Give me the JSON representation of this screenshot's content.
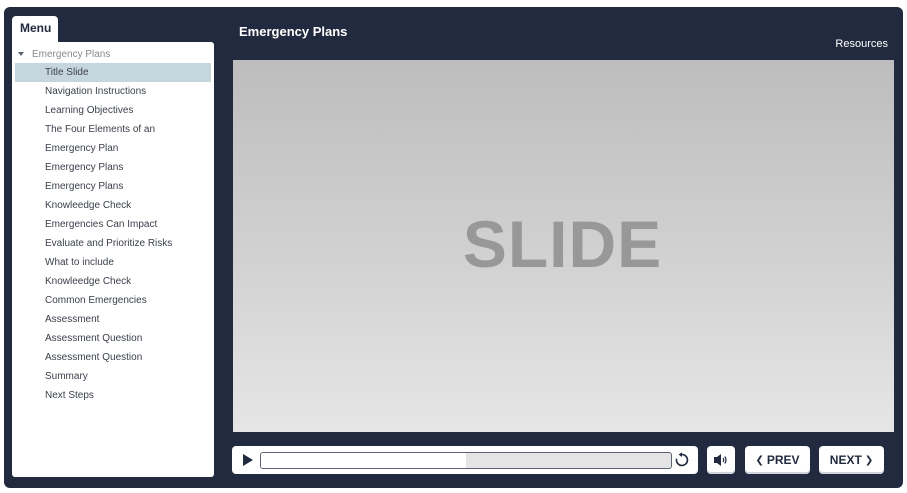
{
  "menu": {
    "tab_label": "Menu",
    "root_label": "Emergency Plans",
    "items": [
      {
        "label": "Title Slide",
        "active": true
      },
      {
        "label": "Navigation Instructions"
      },
      {
        "label": "Learning Objectives"
      },
      {
        "label": "The Four Elements of an"
      },
      {
        "label": "Emergency Plan"
      },
      {
        "label": "Emergency Plans"
      },
      {
        "label": "Emergency Plans"
      },
      {
        "label": "Knowleedge Check"
      },
      {
        "label": "Emergencies Can Impact"
      },
      {
        "label": "Evaluate and Prioritize Risks"
      },
      {
        "label": "What to include"
      },
      {
        "label": "Knowleedge Check"
      },
      {
        "label": "Common Emergencies"
      },
      {
        "label": "Assessment"
      },
      {
        "label": "Assessment Question"
      },
      {
        "label": "Assessment Question"
      },
      {
        "label": "Summary"
      },
      {
        "label": "Next Steps"
      }
    ]
  },
  "header": {
    "title": "Emergency Plans",
    "resources_label": "Resources"
  },
  "slide": {
    "text": "SLIDE"
  },
  "playback": {
    "progress_fraction": 0.5,
    "play_icon": "play-icon",
    "replay_icon": "replay-icon"
  },
  "controls": {
    "mute_icon": "speaker-icon",
    "prev_label": "PREV",
    "next_label": "NEXT"
  },
  "colors": {
    "frame": "#222a3f",
    "active_item": "#c6d6df",
    "slide_text": "#989898"
  }
}
